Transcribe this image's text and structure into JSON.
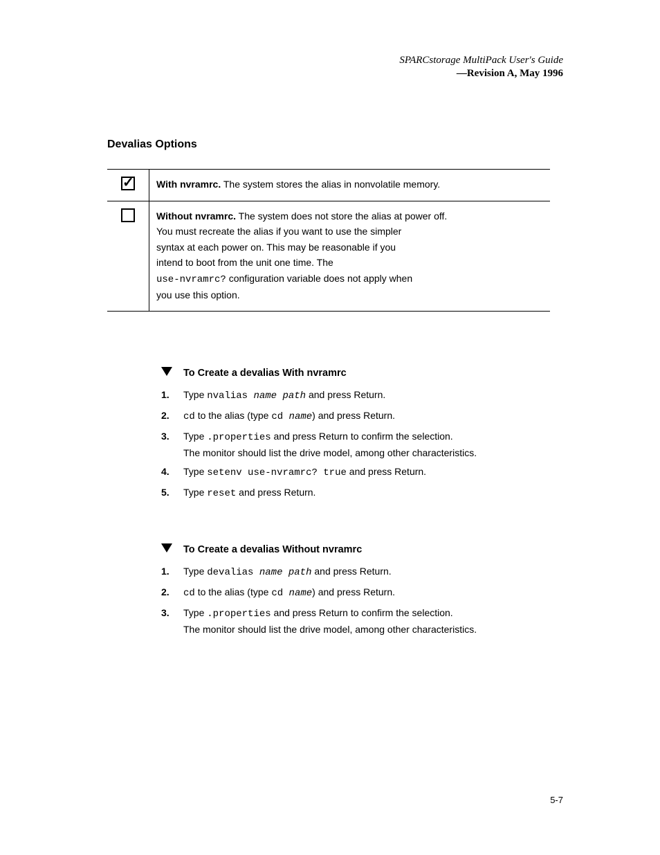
{
  "header": {
    "doc_title": "SPARCstorage MultiPack User's Guide",
    "revision": "—Revision A, May 1996",
    "page_ref": "5-7"
  },
  "section": {
    "heading": "Devalias Options"
  },
  "table": {
    "rows": [
      {
        "checked": true,
        "title": "With nvramrc.",
        "desc": " The system stores the alias in nonvolatile memory."
      },
      {
        "checked": false,
        "title": "Without nvramrc.",
        "desc_lines": [
          " The system does not store the alias at power off.",
          "You must recreate the alias if you want to use the simpler",
          "syntax at each power on. This may be reasonable if you",
          "intend to boot from the unit one time. The",
          " configuration variable does not apply when",
          "you use this option."
        ],
        "mono_inline": "use-nvramrc?"
      }
    ]
  },
  "proc1": {
    "lead": "To Create a devalias With nvramrc",
    "steps": [
      {
        "n": "1.",
        "prefix": "Type ",
        "mono": "nvalias ",
        "italic": "name path",
        "suffix": " and press Return."
      },
      {
        "n": "2.",
        "prefix_mono": "cd",
        "prefix_rest": " to the alias (type ",
        "mono2": "cd ",
        "italic2": "name",
        "suffix2": ") and press Return."
      },
      {
        "n": "3.",
        "prefix": "Type ",
        "mono": ".properties",
        "suffix": " and press Return to confirm the selection.",
        "extra": "The monitor should list the drive model, among other characteristics."
      },
      {
        "n": "4.",
        "prefix": "Type ",
        "mono": "setenv use-nvramrc? true",
        "suffix": " and press Return."
      },
      {
        "n": "5.",
        "prefix": "Type ",
        "mono": "reset",
        "suffix": " and press Return."
      }
    ]
  },
  "proc2": {
    "lead": "To Create a devalias Without nvramrc",
    "steps": [
      {
        "n": "1.",
        "prefix": "Type ",
        "mono": "devalias ",
        "italic": "name path",
        "suffix": " and press Return."
      },
      {
        "n": "2.",
        "prefix_mono": "cd",
        "prefix_rest": " to the alias (type ",
        "mono2": "cd ",
        "italic2": "name",
        "suffix2": ") and press Return."
      },
      {
        "n": "3.",
        "prefix": "Type ",
        "mono": ".properties",
        "suffix": " and press Return to confirm the selection.",
        "extra": "The monitor should list the drive model, among other characteristics."
      }
    ]
  }
}
